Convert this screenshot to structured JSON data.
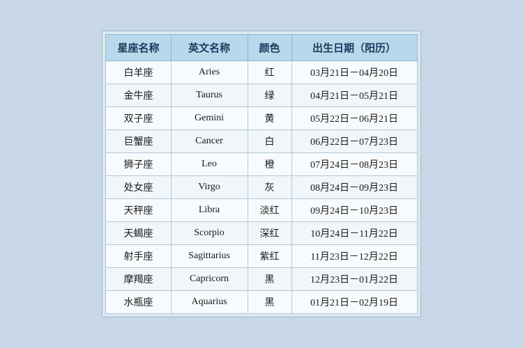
{
  "table": {
    "headers": [
      {
        "key": "cn_name",
        "label": "星座名称"
      },
      {
        "key": "en_name",
        "label": "英文名称"
      },
      {
        "key": "color",
        "label": "颜色"
      },
      {
        "key": "date_range",
        "label": "出生日期（阳历）"
      }
    ],
    "rows": [
      {
        "cn_name": "白羊座",
        "en_name": "Aries",
        "color": "红",
        "date_range": "03月21日－04月20日"
      },
      {
        "cn_name": "金牛座",
        "en_name": "Taurus",
        "color": "绿",
        "date_range": "04月21日－05月21日"
      },
      {
        "cn_name": "双子座",
        "en_name": "Gemini",
        "color": "黄",
        "date_range": "05月22日－06月21日"
      },
      {
        "cn_name": "巨蟹座",
        "en_name": "Cancer",
        "color": "白",
        "date_range": "06月22日－07月23日"
      },
      {
        "cn_name": "狮子座",
        "en_name": "Leo",
        "color": "橙",
        "date_range": "07月24日－08月23日"
      },
      {
        "cn_name": "处女座",
        "en_name": "Virgo",
        "color": "灰",
        "date_range": "08月24日－09月23日"
      },
      {
        "cn_name": "天秤座",
        "en_name": "Libra",
        "color": "淡红",
        "date_range": "09月24日－10月23日"
      },
      {
        "cn_name": "天蝎座",
        "en_name": "Scorpio",
        "color": "深红",
        "date_range": "10月24日－11月22日"
      },
      {
        "cn_name": "射手座",
        "en_name": "Sagittarius",
        "color": "紫红",
        "date_range": "11月23日－12月22日"
      },
      {
        "cn_name": "摩羯座",
        "en_name": "Capricorn",
        "color": "黑",
        "date_range": "12月23日－01月22日"
      },
      {
        "cn_name": "水瓶座",
        "en_name": "Aquarius",
        "color": "黑",
        "date_range": "01月21日－02月19日"
      }
    ]
  }
}
